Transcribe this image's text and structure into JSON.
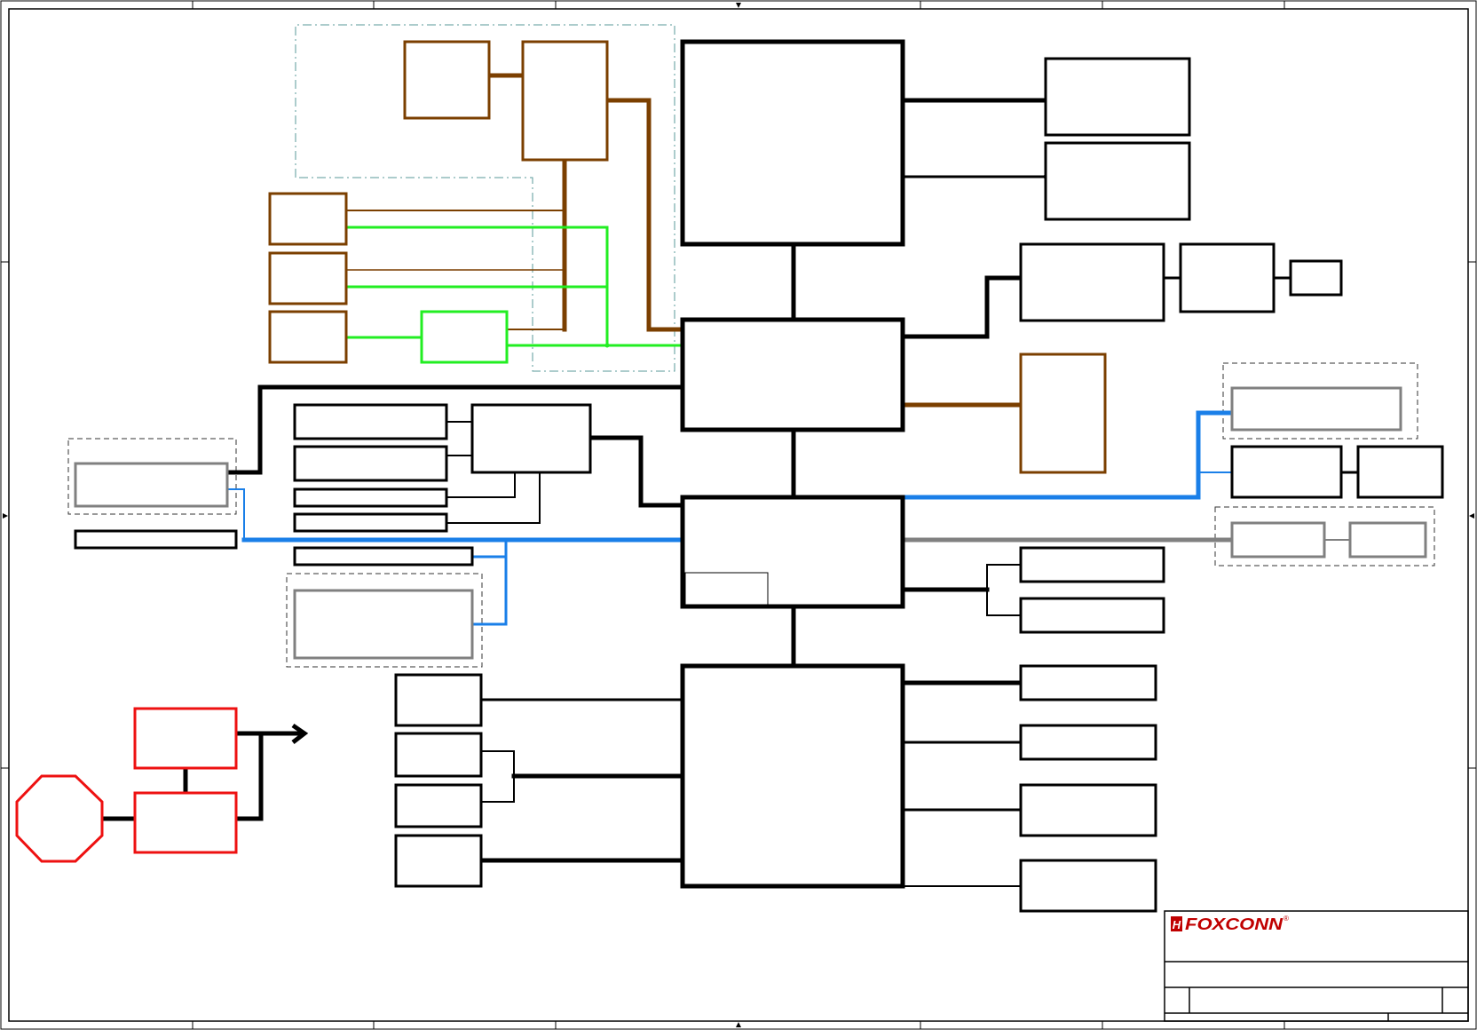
{
  "sheet": {
    "border_color": "#000000",
    "background": "#ffffff"
  },
  "title_block": {
    "logo_text": "FOXCONN",
    "logo_mark": "H",
    "registered_mark": "®",
    "logo_color": "#c00000"
  },
  "colors": {
    "black": "#000000",
    "brown": "#7b3f00",
    "green": "#22ee22",
    "blue": "#1a7fe8",
    "gray": "#808080",
    "red": "#ee1111",
    "dashed_teal": "#5a9a9a",
    "dashed_dark": "#333333"
  },
  "icons": {
    "power_arrow": "arrow-right-icon",
    "power_connector": "octagon-icon"
  }
}
